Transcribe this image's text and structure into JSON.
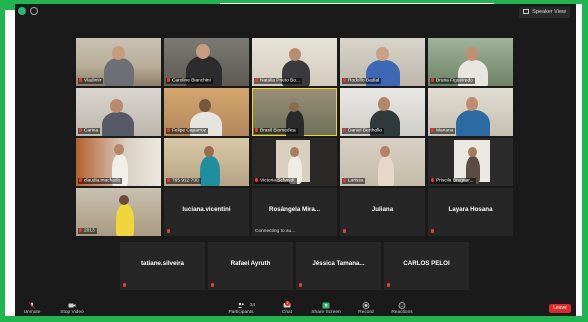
{
  "window": {
    "speaker_view_label": "Speaker View"
  },
  "participants_video": [
    {
      "name": "Vladimir"
    },
    {
      "name": "Caroline Bianchini"
    },
    {
      "name": "Natalia Prieto Bo..."
    },
    {
      "name": "Rodolfo Badial"
    },
    {
      "name": "Bruna Figueiredo"
    },
    {
      "name": "Carina"
    },
    {
      "name": "Felipe Caparroz"
    },
    {
      "name": "Brasil Biomedica"
    },
    {
      "name": "Daniel Berthollo"
    },
    {
      "name": "Mariana"
    },
    {
      "name": "claudia.machado"
    },
    {
      "name": "765 912 700"
    },
    {
      "name": "Victoria Schmidt"
    },
    {
      "name": "Larissa"
    },
    {
      "name": "Priscila Brugnar..."
    },
    {
      "name": "2013"
    }
  ],
  "participants_name_only": [
    {
      "name": "luciana.vicentini",
      "status": ""
    },
    {
      "name": "Rosângela  Mira...",
      "status": "Connecting to au..."
    },
    {
      "name": "Juliana",
      "status": ""
    },
    {
      "name": "Layara Hosana",
      "status": ""
    },
    {
      "name": "tatiane.silveira",
      "status": ""
    },
    {
      "name": "Rafael Ayruth",
      "status": ""
    },
    {
      "name": "Jéssica  Tamana...",
      "status": ""
    },
    {
      "name": "CARLOS PELOI",
      "status": ""
    }
  ],
  "toolbar": {
    "unmute": "Unmute",
    "stop_video": "Stop Video",
    "participants": "Participants",
    "participants_count": "34",
    "chat": "Chat",
    "chat_badge": "2",
    "share_screen": "Share Screen",
    "record": "Record",
    "reactions": "Reactions",
    "leave": "Leave"
  },
  "colors": {
    "frame_green": "#1fb650",
    "active_speaker": "#f2d22b",
    "leave_red": "#e02828",
    "share_green": "#2bb673"
  }
}
